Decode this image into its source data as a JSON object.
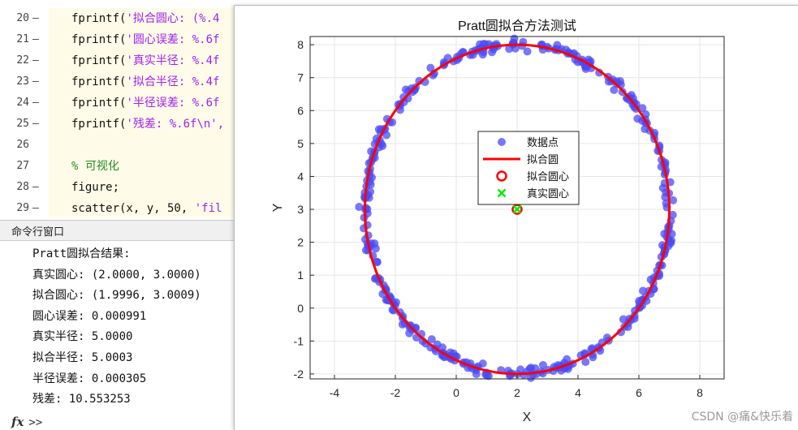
{
  "editor": {
    "lines": [
      {
        "num": "20",
        "marker": "—",
        "segments": [
          {
            "t": "fprintf(",
            "c": "kw"
          },
          {
            "t": "'拟合圆心: (%.4",
            "c": "str"
          }
        ]
      },
      {
        "num": "21",
        "marker": "—",
        "segments": [
          {
            "t": "fprintf(",
            "c": "kw"
          },
          {
            "t": "'圆心误差: %.6f",
            "c": "str"
          }
        ]
      },
      {
        "num": "22",
        "marker": "—",
        "segments": [
          {
            "t": "fprintf(",
            "c": "kw"
          },
          {
            "t": "'真实半径: %.4f",
            "c": "str"
          }
        ]
      },
      {
        "num": "23",
        "marker": "—",
        "segments": [
          {
            "t": "fprintf(",
            "c": "kw"
          },
          {
            "t": "'拟合半径: %.4f",
            "c": "str"
          }
        ]
      },
      {
        "num": "24",
        "marker": "—",
        "segments": [
          {
            "t": "fprintf(",
            "c": "kw"
          },
          {
            "t": "'半径误差: %.6f",
            "c": "str"
          }
        ]
      },
      {
        "num": "25",
        "marker": "—",
        "segments": [
          {
            "t": "fprintf(",
            "c": "kw"
          },
          {
            "t": "'残差: %.6f\\n',",
            "c": "str"
          }
        ]
      },
      {
        "num": "26",
        "marker": "",
        "segments": []
      },
      {
        "num": "27",
        "marker": "",
        "segments": [
          {
            "t": "% 可视化",
            "c": "cmt"
          }
        ]
      },
      {
        "num": "28",
        "marker": "—",
        "segments": [
          {
            "t": "figure;",
            "c": "kw"
          }
        ]
      },
      {
        "num": "29",
        "marker": "—",
        "segments": [
          {
            "t": "scatter(x, y, 50, ",
            "c": "kw"
          },
          {
            "t": "'fil",
            "c": "str"
          }
        ]
      }
    ]
  },
  "command_window": {
    "title": "命令行窗口",
    "output": [
      "Pratt圆拟合结果:",
      "真实圆心: (2.0000, 3.0000)",
      "拟合圆心: (1.9996, 3.0009)",
      "圆心误差: 0.000991",
      "真实半径: 5.0000",
      "拟合半径: 5.0003",
      "半径误差: 0.000305",
      "残差: 10.553253"
    ],
    "fx_icon": "fx",
    "prompt": ">>"
  },
  "watermark": "CSDN @痛&快乐着",
  "chart_data": {
    "type": "scatter",
    "title": "Pratt圆拟合方法测试",
    "xlabel": "X",
    "ylabel": "Y",
    "xlim": [
      -4.8,
      8.8
    ],
    "ylim": [
      -2.15,
      8.25
    ],
    "xticks": [
      -4,
      -2,
      0,
      2,
      4,
      6,
      8
    ],
    "yticks": [
      -2,
      -1,
      0,
      1,
      2,
      3,
      4,
      5,
      6,
      7,
      8
    ],
    "grid": true,
    "legend_position": "center",
    "series": [
      {
        "name": "数据点",
        "kind": "scatter",
        "color": "#4b4bf5",
        "center": [
          2,
          3
        ],
        "radius": 5,
        "noise": 0.15,
        "count": 400
      },
      {
        "name": "拟合圆",
        "kind": "circle",
        "color": "#ff0000",
        "center": [
          1.9996,
          3.0009
        ],
        "radius": 5.0003
      },
      {
        "name": "拟合圆心",
        "kind": "marker-circle",
        "color": "#ff0000",
        "x": 1.9996,
        "y": 3.0009
      },
      {
        "name": "真实圆心",
        "kind": "marker-x",
        "color": "#00ee00",
        "x": 2,
        "y": 3
      }
    ]
  }
}
